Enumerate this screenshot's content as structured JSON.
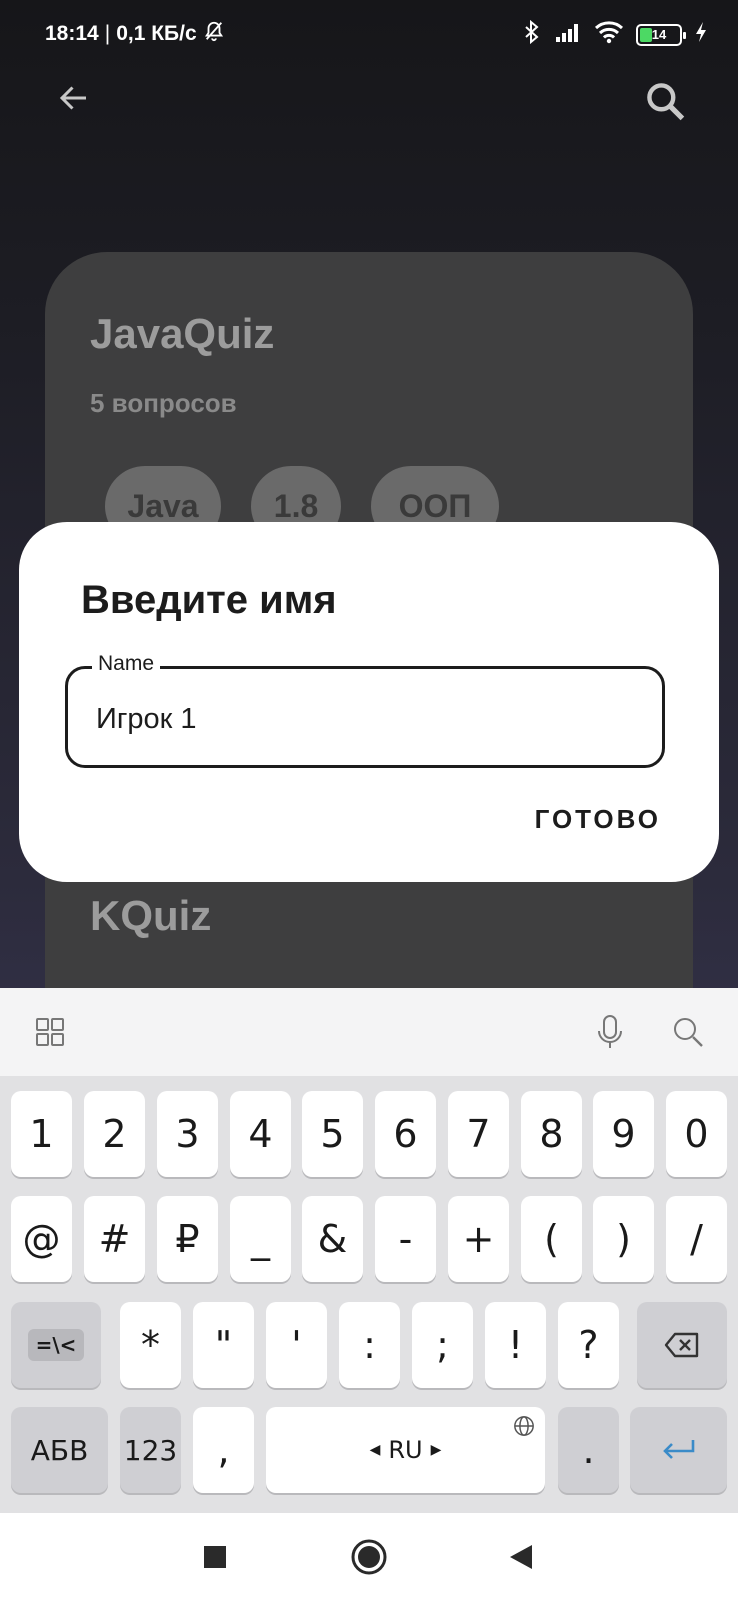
{
  "status_bar": {
    "time": "18:14",
    "separator": "|",
    "speed": "0,1 КБ/с",
    "battery": "14",
    "icons": [
      "bell-off-icon",
      "bluetooth-icon",
      "signal-icon",
      "wifi-icon",
      "battery-icon",
      "charging-icon"
    ]
  },
  "app_bar": {
    "icons": [
      "arrow-back-icon",
      "search-icon"
    ]
  },
  "quiz_cards": [
    {
      "title": "JavaQuiz",
      "subtitle": "5 вопросов",
      "tags": [
        "Java",
        "1.8",
        "ООП"
      ]
    },
    {
      "title": "KQuiz"
    }
  ],
  "dialog": {
    "title": "Введите имя",
    "field_label": "Name",
    "field_value": "Игрок 1",
    "done_label": "ГОТОВО"
  },
  "keyboard": {
    "toolbar_icons": [
      "grid-icon",
      "mic-icon",
      "search-icon"
    ],
    "row1": [
      "1",
      "2",
      "3",
      "4",
      "5",
      "6",
      "7",
      "8",
      "9",
      "0"
    ],
    "row2": [
      "@",
      "#",
      "₽",
      "_",
      "&",
      "-",
      "+",
      "(",
      ")",
      "/"
    ],
    "row3": [
      "=\\<",
      "*",
      "\"",
      "'",
      ":",
      ";",
      "!",
      "?"
    ],
    "row4": {
      "abc": "АБВ",
      "num": "123",
      "comma": ",",
      "space": "RU",
      "period": "."
    }
  },
  "nav_bar": {
    "icons": [
      "recents-icon",
      "home-icon",
      "back-icon"
    ]
  },
  "colors": {
    "accent": "#3a8bc8",
    "card": "#3e3e3f",
    "dialog": "#ffffff",
    "battery": "#4cd964"
  }
}
